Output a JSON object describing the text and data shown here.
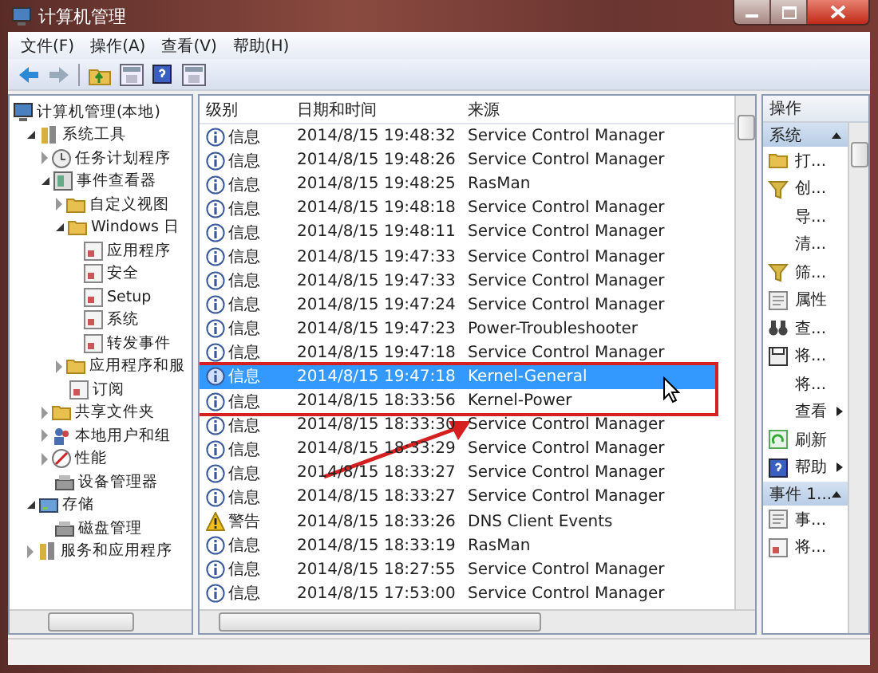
{
  "window": {
    "title": "计算机管理"
  },
  "menu": [
    "文件(F)",
    "操作(A)",
    "查看(V)",
    "帮助(H)"
  ],
  "toolbar": [
    {
      "kind": "back"
    },
    {
      "kind": "forward"
    },
    {
      "kind": "separator"
    },
    {
      "kind": "up"
    },
    {
      "kind": "panel"
    },
    {
      "kind": "help"
    },
    {
      "kind": "panel"
    }
  ],
  "tree": [
    {
      "label": "计算机管理(本地)",
      "kind": "computer",
      "children": [
        {
          "label": "系统工具",
          "kind": "tools",
          "expanded": true,
          "children": [
            {
              "label": "任务计划程序",
              "kind": "clock",
              "expanded": false
            },
            {
              "label": "事件查看器",
              "kind": "viewer",
              "expanded": true,
              "children": [
                {
                  "label": "自定义视图",
                  "kind": "folder",
                  "expanded": false
                },
                {
                  "label": "Windows 日",
                  "kind": "folder",
                  "expanded": true,
                  "children": [
                    {
                      "label": "应用程序",
                      "kind": "log"
                    },
                    {
                      "label": "安全",
                      "kind": "log"
                    },
                    {
                      "label": "Setup",
                      "kind": "log"
                    },
                    {
                      "label": "系统",
                      "kind": "log"
                    },
                    {
                      "label": "转发事件",
                      "kind": "log"
                    }
                  ]
                },
                {
                  "label": "应用程序和服",
                  "kind": "folder",
                  "expanded": false
                },
                {
                  "label": "订阅",
                  "kind": "log"
                }
              ]
            },
            {
              "label": "共享文件夹",
              "kind": "folder",
              "expanded": false
            },
            {
              "label": "本地用户和组",
              "kind": "users",
              "expanded": false
            },
            {
              "label": "性能",
              "kind": "gauge",
              "expanded": false
            },
            {
              "label": "设备管理器",
              "kind": "device"
            }
          ]
        },
        {
          "label": "存储",
          "kind": "disk",
          "expanded": true,
          "children": [
            {
              "label": "磁盘管理",
              "kind": "device"
            }
          ]
        },
        {
          "label": "服务和应用程序",
          "kind": "tools",
          "expanded": false
        }
      ]
    }
  ],
  "table": {
    "columns": [
      "级别",
      "日期和时间",
      "来源"
    ],
    "rows": [
      {
        "kind": "info",
        "level": "信息",
        "time": "2014/8/15 19:48:32",
        "source": "Service Control Manager",
        "selected": false,
        "marked": false
      },
      {
        "kind": "info",
        "level": "信息",
        "time": "2014/8/15 19:48:26",
        "source": "Service Control Manager",
        "selected": false,
        "marked": false
      },
      {
        "kind": "info",
        "level": "信息",
        "time": "2014/8/15 19:48:25",
        "source": "RasMan",
        "selected": false,
        "marked": false
      },
      {
        "kind": "info",
        "level": "信息",
        "time": "2014/8/15 19:48:18",
        "source": "Service Control Manager",
        "selected": false,
        "marked": false
      },
      {
        "kind": "info",
        "level": "信息",
        "time": "2014/8/15 19:48:11",
        "source": "Service Control Manager",
        "selected": false,
        "marked": false
      },
      {
        "kind": "info",
        "level": "信息",
        "time": "2014/8/15 19:47:33",
        "source": "Service Control Manager",
        "selected": false,
        "marked": false
      },
      {
        "kind": "info",
        "level": "信息",
        "time": "2014/8/15 19:47:33",
        "source": "Service Control Manager",
        "selected": false,
        "marked": false
      },
      {
        "kind": "info",
        "level": "信息",
        "time": "2014/8/15 19:47:24",
        "source": "Service Control Manager",
        "selected": false,
        "marked": false
      },
      {
        "kind": "info",
        "level": "信息",
        "time": "2014/8/15 19:47:23",
        "source": "Power-Troubleshooter",
        "selected": false,
        "marked": false
      },
      {
        "kind": "info",
        "level": "信息",
        "time": "2014/8/15 19:47:18",
        "source": "Service Control Manager",
        "selected": false,
        "marked": false
      },
      {
        "kind": "info",
        "level": "信息",
        "time": "2014/8/15 19:47:18",
        "source": "Kernel-General",
        "selected": true,
        "marked": true
      },
      {
        "kind": "info",
        "level": "信息",
        "time": "2014/8/15 18:33:56",
        "source": "Kernel-Power",
        "selected": false,
        "marked": true
      },
      {
        "kind": "info",
        "level": "信息",
        "time": "2014/8/15 18:33:30",
        "source": "Service Control Manager",
        "selected": false,
        "marked": false
      },
      {
        "kind": "info",
        "level": "信息",
        "time": "2014/8/15 18:33:29",
        "source": "Service Control Manager",
        "selected": false,
        "marked": false
      },
      {
        "kind": "info",
        "level": "信息",
        "time": "2014/8/15 18:33:27",
        "source": "Service Control Manager",
        "selected": false,
        "marked": false
      },
      {
        "kind": "info",
        "level": "信息",
        "time": "2014/8/15 18:33:27",
        "source": "Service Control Manager",
        "selected": false,
        "marked": false
      },
      {
        "kind": "warning",
        "level": "警告",
        "time": "2014/8/15 18:33:26",
        "source": "DNS Client Events",
        "selected": false,
        "marked": false
      },
      {
        "kind": "info",
        "level": "信息",
        "time": "2014/8/15 18:33:19",
        "source": "RasMan",
        "selected": false,
        "marked": false
      },
      {
        "kind": "info",
        "level": "信息",
        "time": "2014/8/15 18:27:55",
        "source": "Service Control Manager",
        "selected": false,
        "marked": false
      },
      {
        "kind": "info",
        "level": "信息",
        "time": "2014/8/15 17:53:00",
        "source": "Service Control Manager",
        "selected": false,
        "marked": false
      }
    ]
  },
  "actions": {
    "title": "操作",
    "sections": [
      {
        "title": "系统",
        "expanded": true,
        "items": [
          {
            "label": "打...",
            "kind": "folder"
          },
          {
            "label": "创...",
            "kind": "filter"
          },
          {
            "label": "导..."
          },
          {
            "label": "清..."
          },
          {
            "label": "筛...",
            "kind": "filter"
          },
          {
            "label": "属性",
            "kind": "properties"
          },
          {
            "label": "查...",
            "kind": "binoculars"
          },
          {
            "label": "将...",
            "kind": "save"
          },
          {
            "label": "将..."
          },
          {
            "label": "查看",
            "submenu": true
          },
          {
            "label": "刷新",
            "kind": "refresh"
          },
          {
            "label": "帮助",
            "kind": "help",
            "submenu": true
          }
        ]
      },
      {
        "title": "事件 1...",
        "expanded": true,
        "items": [
          {
            "label": "事...",
            "kind": "properties"
          },
          {
            "label": "将...",
            "kind": "log"
          }
        ]
      }
    ]
  }
}
